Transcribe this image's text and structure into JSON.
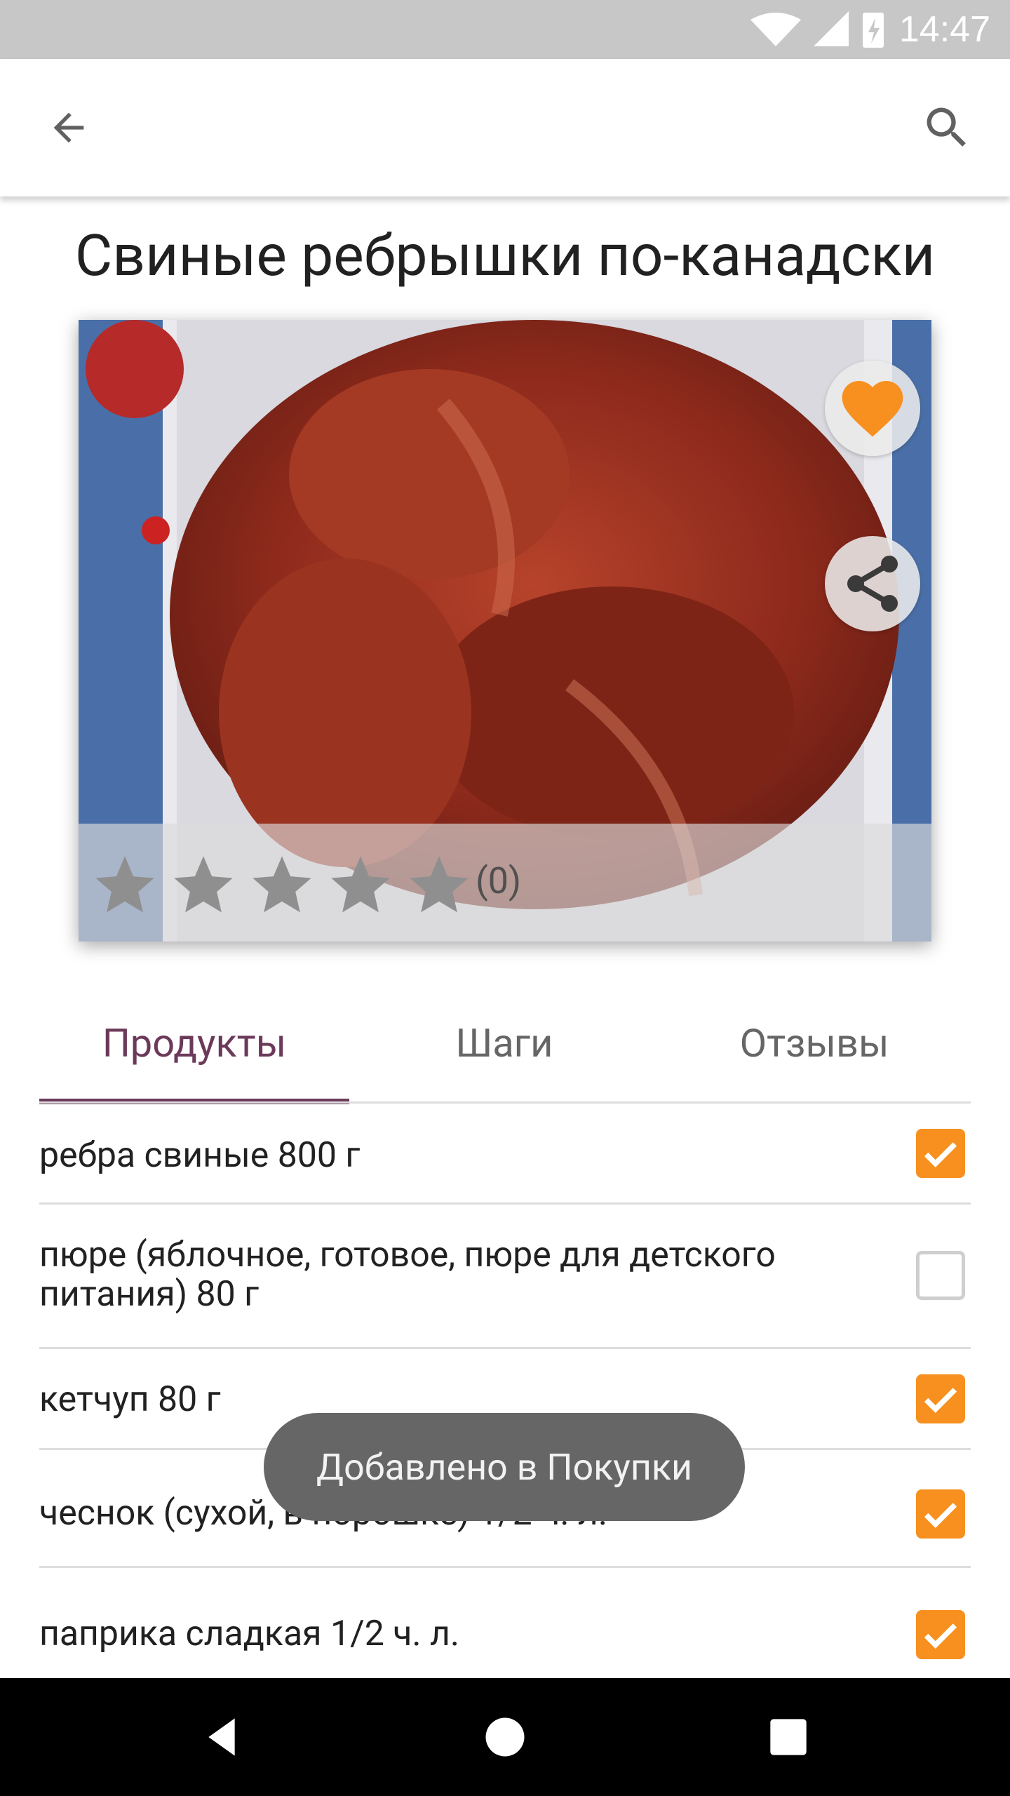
{
  "status_bar": {
    "time": "14:47"
  },
  "app_bar": {
    "back_icon": "arrow-back-icon",
    "search_icon": "search-icon"
  },
  "recipe": {
    "title": "Свиные ребрышки по-канадски",
    "rating_stars": 0,
    "rating_count": "(0)"
  },
  "actions": {
    "favorite_icon": "heart-icon",
    "share_icon": "share-icon",
    "favorite_color": "#f7901e"
  },
  "tabs": [
    {
      "label": "Продукты",
      "active": true
    },
    {
      "label": "Шаги",
      "active": false
    },
    {
      "label": "Отзывы",
      "active": false
    }
  ],
  "ingredients": [
    {
      "text": "ребра свиные 800 г",
      "checked": true
    },
    {
      "text": "пюре (яблочное, готовое, пюре для детского питания) 80 г",
      "checked": false
    },
    {
      "text": "кетчуп 80 г",
      "checked": true
    },
    {
      "text": "чеснок (сухой, в порошке) 1/2 ч. л.",
      "checked": true
    },
    {
      "text": "паприка сладкая 1/2 ч. л.",
      "checked": true
    }
  ],
  "toast": {
    "text": "Добавлено в Покупки"
  },
  "colors": {
    "accent": "#6b3a5a",
    "checkbox": "#f7901e",
    "status_bar": "#c7c7c7"
  }
}
